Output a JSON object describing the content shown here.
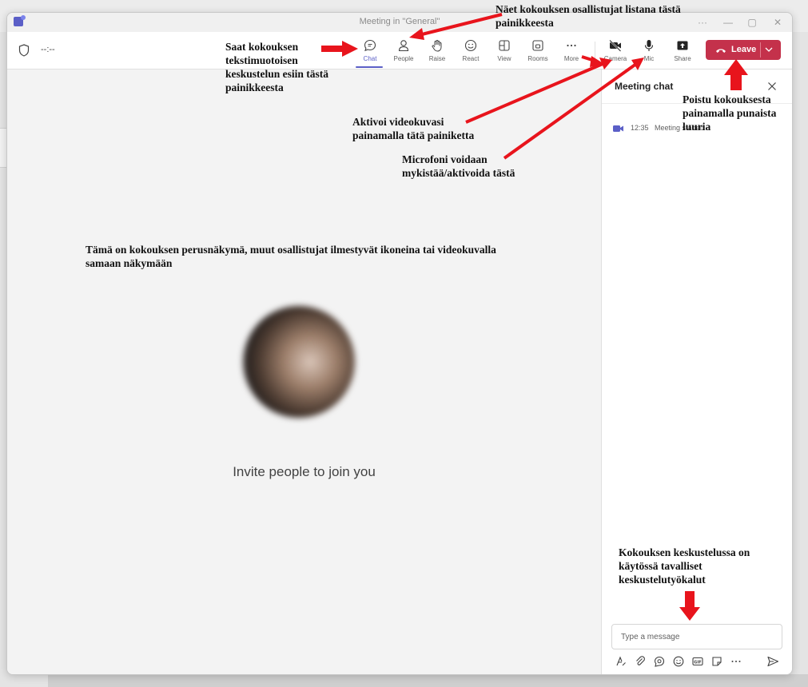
{
  "window": {
    "title": "Meeting in \"General\"",
    "min": "—",
    "max": "▢",
    "close": "✕"
  },
  "toolbar": {
    "timer": "--:--",
    "buttons": [
      {
        "label": "Chat",
        "icon": "chat-icon"
      },
      {
        "label": "People",
        "icon": "people-icon"
      },
      {
        "label": "Raise",
        "icon": "raise-hand-icon"
      },
      {
        "label": "React",
        "icon": "react-icon"
      },
      {
        "label": "View",
        "icon": "view-icon"
      },
      {
        "label": "Rooms",
        "icon": "rooms-icon"
      },
      {
        "label": "More",
        "icon": "more-icon"
      },
      {
        "label": "Camera",
        "icon": "camera-off-icon"
      },
      {
        "label": "Mic",
        "icon": "mic-icon"
      },
      {
        "label": "Share",
        "icon": "share-icon"
      }
    ],
    "leave_label": "Leave"
  },
  "stage": {
    "invite_text": "Invite people to join you"
  },
  "chat_panel": {
    "title": "Meeting chat",
    "messages": [
      {
        "time": "12:35",
        "text": "Meeting started"
      }
    ],
    "input_placeholder": "Type a message"
  },
  "annotations": {
    "participants": "Näet kokouksen osallistujat listana tästä painikkeesta",
    "chat": "Saat kokouksen tekstimuotoisen keskustelun esiin tästä painikkeesta",
    "video": "Aktivoi videokuvasi painamalla tätä painiketta",
    "mic": "Microfoni voidaan mykistää/aktivoida tästä",
    "leave": "Poistu kokouksesta painamalla punaista luuria",
    "main_view": "Tämä on kokouksen perusnäkymä, muut osallistujat ilmestyvät ikoneina tai videokuvalla samaan näkymään",
    "chat_tools": "Kokouksen keskustelussa on käytössä tavalliset keskustelutyökalut"
  },
  "colors": {
    "accent": "#5b5fc7",
    "leave": "#c4314b",
    "arrow": "#e8141c"
  }
}
